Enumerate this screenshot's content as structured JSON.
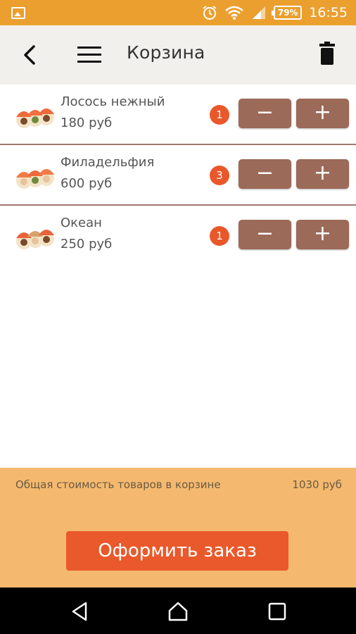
{
  "status_bar": {
    "battery": "79%",
    "time": "16:55",
    "icons": [
      "image-icon",
      "alarm-icon",
      "wifi-icon",
      "signal-icon",
      "battery-icon"
    ]
  },
  "toolbar": {
    "title": "Корзина",
    "icons": [
      "back-arrow-icon",
      "menu-icon",
      "trash-icon"
    ]
  },
  "cart": {
    "items": [
      {
        "name": "Лосось нежный",
        "price": "180 руб",
        "quantity": "1",
        "minus_label": "−",
        "plus_label": "+"
      },
      {
        "name": "Филадельфия",
        "price": "600 руб",
        "quantity": "3",
        "minus_label": "−",
        "plus_label": "+"
      },
      {
        "name": "Океан",
        "price": "250 руб",
        "quantity": "1",
        "minus_label": "−",
        "plus_label": "+"
      }
    ]
  },
  "summary": {
    "total_label": "Общая стоимость товаров в корзине",
    "total_value": "1030 руб",
    "checkout_label": "Оформить заказ"
  },
  "navbar": {
    "icons": [
      "nav-back-icon",
      "nav-home-icon",
      "nav-recent-icon"
    ]
  },
  "colors": {
    "status_bar": "#eb9f2f",
    "toolbar_bg": "#f2f0ed",
    "qty_button": "#9c6a58",
    "badge": "#e9582a",
    "summary_panel": "#f4b96e",
    "checkout_button": "#e9592b"
  }
}
